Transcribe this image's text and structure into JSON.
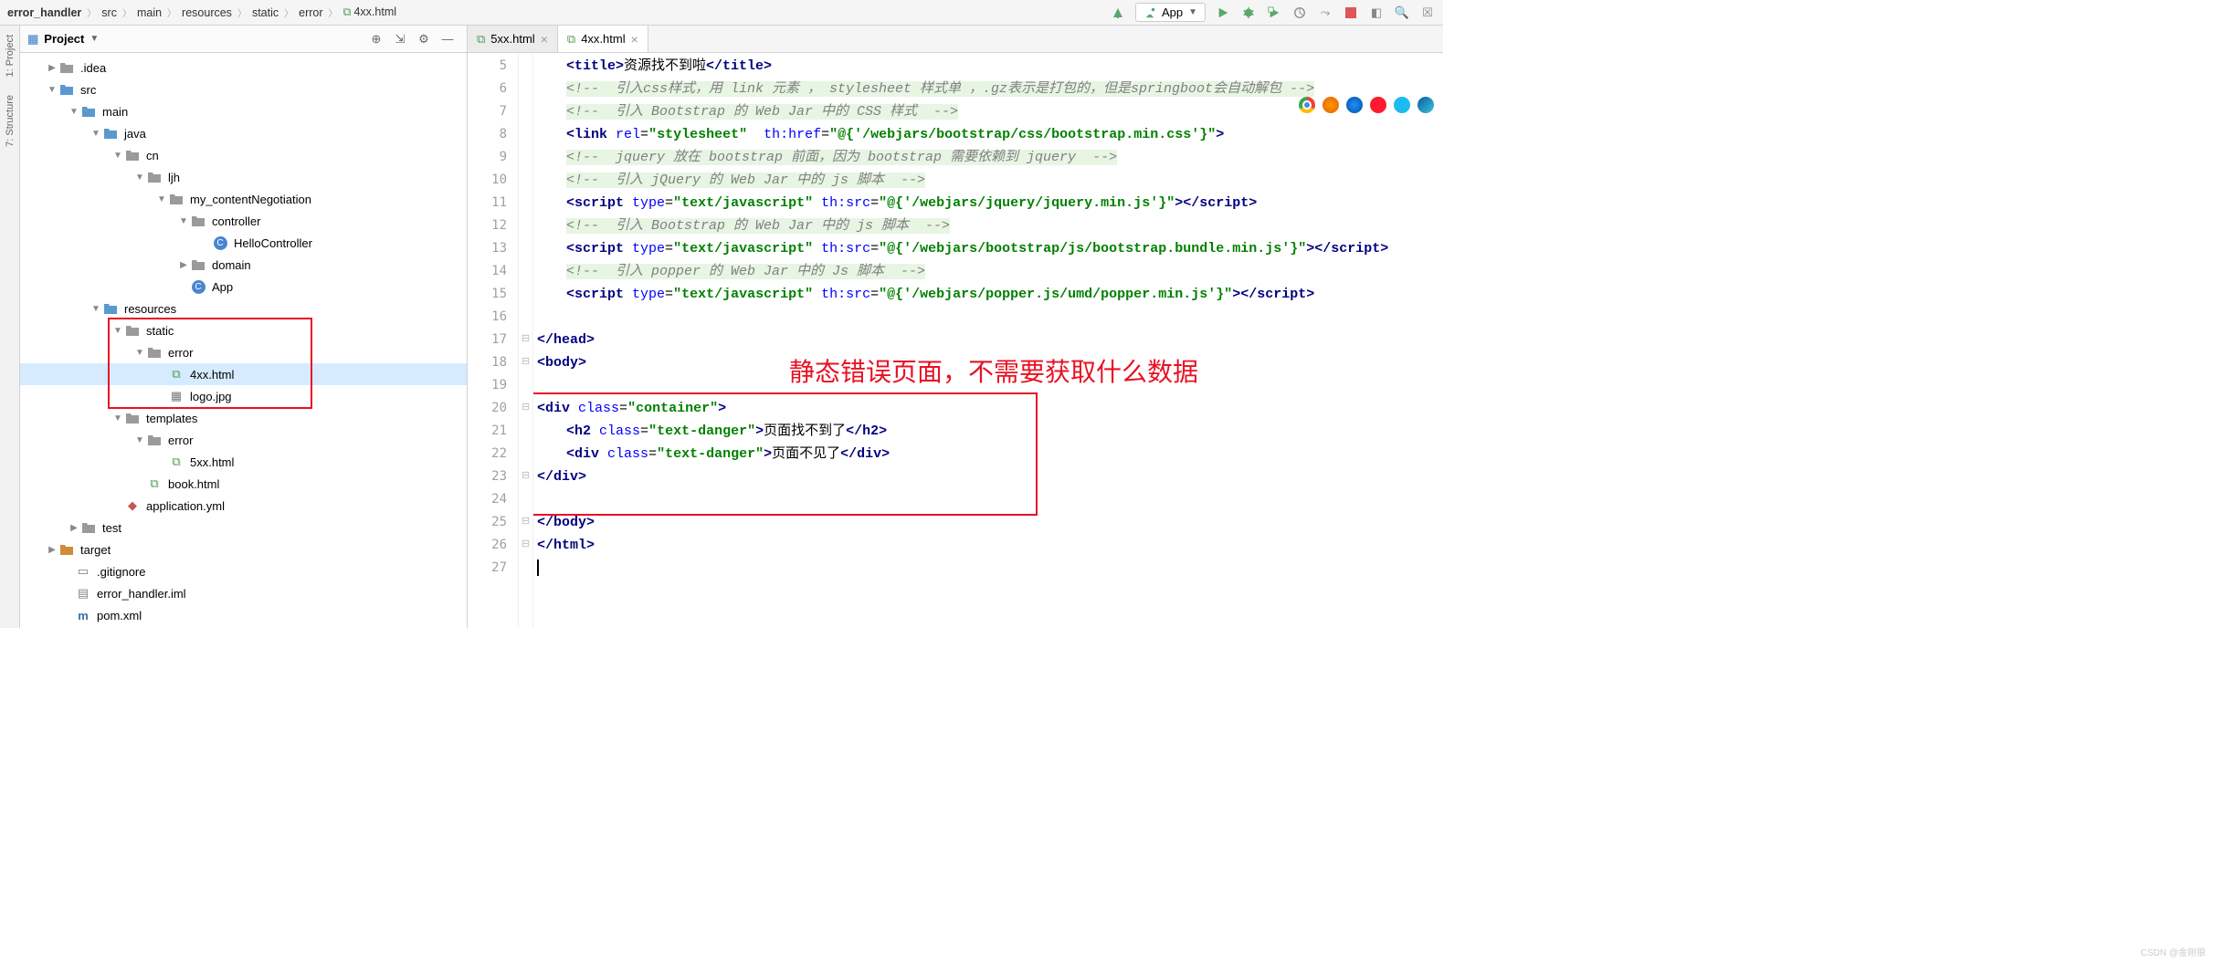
{
  "breadcrumb": [
    "error_handler",
    "src",
    "main",
    "resources",
    "static",
    "error",
    "4xx.html"
  ],
  "rail": {
    "project": "1: Project",
    "structure": "7: Structure"
  },
  "run_config": {
    "label": "App"
  },
  "project_header": {
    "title": "Project"
  },
  "tree": [
    {
      "pad": 28,
      "arrow": "▶",
      "kind": "folder-grey",
      "label": ".idea"
    },
    {
      "pad": 28,
      "arrow": "▼",
      "kind": "folder-blue",
      "label": "src"
    },
    {
      "pad": 52,
      "arrow": "▼",
      "kind": "folder-blue",
      "label": "main"
    },
    {
      "pad": 76,
      "arrow": "▼",
      "kind": "folder-blue",
      "label": "java"
    },
    {
      "pad": 100,
      "arrow": "▼",
      "kind": "folder-grey",
      "label": "cn"
    },
    {
      "pad": 124,
      "arrow": "▼",
      "kind": "folder-grey",
      "label": "ljh"
    },
    {
      "pad": 148,
      "arrow": "▼",
      "kind": "folder-grey",
      "label": "my_contentNegotiation"
    },
    {
      "pad": 172,
      "arrow": "▼",
      "kind": "folder-grey",
      "label": "controller"
    },
    {
      "pad": 196,
      "arrow": "",
      "kind": "class",
      "label": "HelloController"
    },
    {
      "pad": 172,
      "arrow": "▶",
      "kind": "folder-grey",
      "label": "domain"
    },
    {
      "pad": 172,
      "arrow": "",
      "kind": "class-run",
      "label": "App"
    },
    {
      "pad": 76,
      "arrow": "▼",
      "kind": "folder-blue",
      "label": "resources"
    },
    {
      "pad": 100,
      "arrow": "▼",
      "kind": "folder-grey",
      "label": "static"
    },
    {
      "pad": 124,
      "arrow": "▼",
      "kind": "folder-grey",
      "label": "error"
    },
    {
      "pad": 148,
      "arrow": "",
      "kind": "html",
      "label": "4xx.html",
      "selected": true
    },
    {
      "pad": 148,
      "arrow": "",
      "kind": "img",
      "label": "logo.jpg"
    },
    {
      "pad": 100,
      "arrow": "▼",
      "kind": "folder-grey",
      "label": "templates"
    },
    {
      "pad": 124,
      "arrow": "▼",
      "kind": "folder-grey",
      "label": "error"
    },
    {
      "pad": 148,
      "arrow": "",
      "kind": "html",
      "label": "5xx.html"
    },
    {
      "pad": 124,
      "arrow": "",
      "kind": "html",
      "label": "book.html"
    },
    {
      "pad": 100,
      "arrow": "",
      "kind": "yml",
      "label": "application.yml"
    },
    {
      "pad": 52,
      "arrow": "▶",
      "kind": "folder-grey",
      "label": "test"
    },
    {
      "pad": 28,
      "arrow": "▶",
      "kind": "folder-orange",
      "label": "target"
    },
    {
      "pad": 46,
      "arrow": "",
      "kind": "file",
      "label": ".gitignore"
    },
    {
      "pad": 46,
      "arrow": "",
      "kind": "iml",
      "label": "error_handler.iml"
    },
    {
      "pad": 46,
      "arrow": "",
      "kind": "pom",
      "label": "pom.xml"
    }
  ],
  "tabs": [
    {
      "label": "5xx.html",
      "active": false
    },
    {
      "label": "4xx.html",
      "active": true
    }
  ],
  "gutter_start": 5,
  "gutter_end": 27,
  "code_lines": [
    {
      "i": 1,
      "html": "<span class='tag'>&lt;title&gt;</span><span class='txt'>资源找不到啦</span><span class='tag'>&lt;/title&gt;</span>"
    },
    {
      "i": 1,
      "html": "<span class='comment'>&lt;!--  引入css样式，用 link 元素 ， stylesheet 样式单 ，.gz表示是打包的，但是springboot会自动解包 --&gt;</span>"
    },
    {
      "i": 1,
      "html": "<span class='comment'>&lt;!--  引入 Bootstrap 的 Web Jar 中的 CSS 样式  --&gt;</span>"
    },
    {
      "i": 1,
      "html": "<span class='tag'>&lt;link</span> <span class='attr'>rel</span>=<span class='val'>\"stylesheet\"</span>  <span class='attr'>th:href</span>=<span class='val'>\"@{'/webjars/bootstrap/css/bootstrap.min.css'}\"</span><span class='tag'>&gt;</span>"
    },
    {
      "i": 1,
      "html": "<span class='comment'>&lt;!--  jquery 放在 bootstrap 前面，因为 bootstrap 需要依赖到 jquery  --&gt;</span>"
    },
    {
      "i": 1,
      "html": "<span class='comment'>&lt;!--  引入 jQuery 的 Web Jar 中的 js 脚本  --&gt;</span>"
    },
    {
      "i": 1,
      "html": "<span class='tag'>&lt;script</span> <span class='attr'>type</span>=<span class='val'>\"text/javascript\"</span> <span class='attr'>th:src</span>=<span class='val'>\"@{'/webjars/jquery/jquery.min.js'}\"</span><span class='tag'>&gt;&lt;/script&gt;</span>"
    },
    {
      "i": 1,
      "html": "<span class='comment'>&lt;!--  引入 Bootstrap 的 Web Jar 中的 js 脚本  --&gt;</span>"
    },
    {
      "i": 1,
      "html": "<span class='tag'>&lt;script</span> <span class='attr'>type</span>=<span class='val'>\"text/javascript\"</span> <span class='attr'>th:src</span>=<span class='val'>\"@{'/webjars/bootstrap/js/bootstrap.bundle.min.js'}\"</span><span class='tag'>&gt;&lt;/script&gt;</span>"
    },
    {
      "i": 1,
      "html": "<span class='comment'>&lt;!--  引入 popper 的 Web Jar 中的 Js 脚本  --&gt;</span>"
    },
    {
      "i": 1,
      "html": "<span class='tag'>&lt;script</span> <span class='attr'>type</span>=<span class='val'>\"text/javascript\"</span> <span class='attr'>th:src</span>=<span class='val'>\"@{'/webjars/popper.js/umd/popper.min.js'}\"</span><span class='tag'>&gt;&lt;/script&gt;</span>"
    },
    {
      "i": 1,
      "html": ""
    },
    {
      "i": 0,
      "html": "<span class='tag'>&lt;/head&gt;</span>"
    },
    {
      "i": 0,
      "html": "<span class='tag'>&lt;body&gt;</span>"
    },
    {
      "i": 0,
      "html": ""
    },
    {
      "i": 0,
      "html": "<span class='tag'>&lt;div</span> <span class='attr'>class</span>=<span class='val'>\"container\"</span><span class='tag'>&gt;</span>"
    },
    {
      "i": 1,
      "html": "<span class='tag'>&lt;h2</span> <span class='attr'>class</span>=<span class='val'>\"text-danger\"</span><span class='tag'>&gt;</span><span class='txt'>页面找不到了</span><span class='tag'>&lt;/h2&gt;</span>"
    },
    {
      "i": 1,
      "html": "<span class='tag'>&lt;div</span> <span class='attr'>class</span>=<span class='val'>\"text-danger\"</span><span class='tag'>&gt;</span><span class='txt'>页面不见了</span><span class='tag'>&lt;/div&gt;</span>"
    },
    {
      "i": 0,
      "html": "<span class='tag'>&lt;/div&gt;</span>"
    },
    {
      "i": 0,
      "html": ""
    },
    {
      "i": 0,
      "html": "<span class='tag'>&lt;/body&gt;</span>"
    },
    {
      "i": 0,
      "html": "<span class='tag'>&lt;/html&gt;</span>"
    },
    {
      "i": 0,
      "html": "<span class='cursor-bar'></span>"
    }
  ],
  "annotation": "静态错误页面，不需要获取什么数据",
  "watermark": "CSDN @金刚狼"
}
